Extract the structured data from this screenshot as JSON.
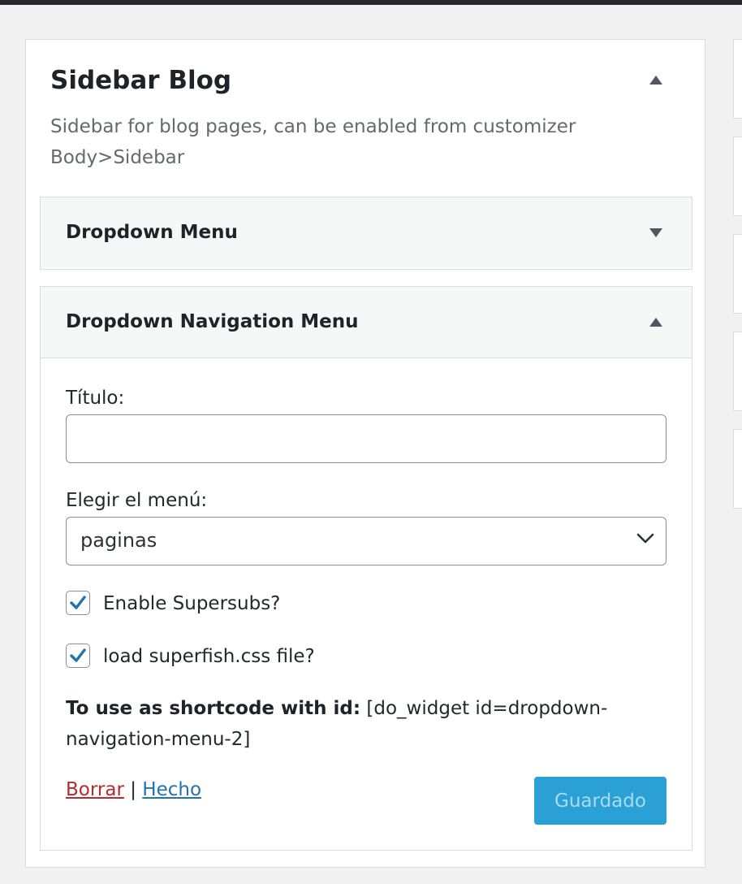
{
  "sidebar": {
    "title": "Sidebar Blog",
    "description": "Sidebar for blog pages, can be enabled from customizer Body>Sidebar",
    "toggle_icon": "triangle-up-icon"
  },
  "widgets": [
    {
      "title": "Dropdown Menu",
      "expanded": false,
      "toggle_icon": "triangle-down-icon"
    },
    {
      "title": "Dropdown Navigation Menu",
      "expanded": true,
      "toggle_icon": "triangle-up-icon",
      "form": {
        "title_label": "Título:",
        "title_value": "",
        "menu_label": "Elegir el menú:",
        "menu_selected": "paginas",
        "checkboxes": [
          {
            "label": "Enable Supersubs?",
            "checked": true
          },
          {
            "label": "load superfish.css file?",
            "checked": true
          }
        ],
        "shortcode_label": "To use as shortcode with id:",
        "shortcode_value": "[do_widget id=dropdown-navigation-menu-2]",
        "delete_label": "Borrar",
        "separator": "|",
        "done_label": "Hecho",
        "save_label": "Guardado"
      }
    }
  ],
  "colors": {
    "background": "#f1f1f1",
    "link": "#2271b1",
    "delete_link": "#b32d2e",
    "button": "#2ba0d4",
    "checkmark": "#2271b1"
  }
}
